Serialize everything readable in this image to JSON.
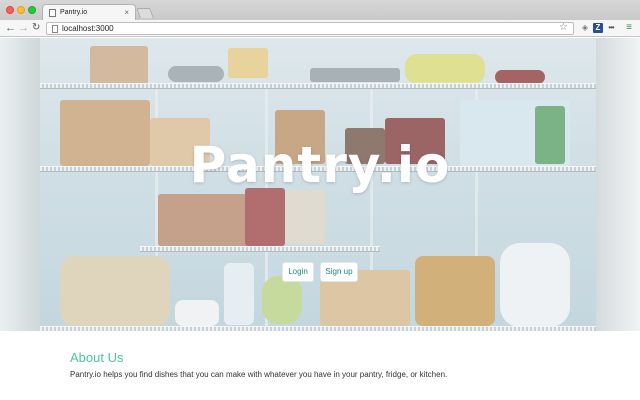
{
  "browser": {
    "tab_title": "Pantry.io",
    "tab_close": "×",
    "url": "localhost:3000",
    "icons": [
      "back-arrow-icon",
      "forward-arrow-icon",
      "reload-icon",
      "page-icon",
      "bookmark-star-icon",
      "extension-icons",
      "menu-icon"
    ]
  },
  "hero": {
    "logo": "Pantry.io",
    "login_label": "Login",
    "signup_label": "Sign up"
  },
  "about": {
    "title": "About Us",
    "text": "Pantry.io helps you find dishes that you can make with whatever you have in your pantry, fridge, or kitchen."
  },
  "colors": {
    "accent": "#4fc3a1",
    "button_text": "#1a8f7a",
    "logo": "#ffffff"
  }
}
